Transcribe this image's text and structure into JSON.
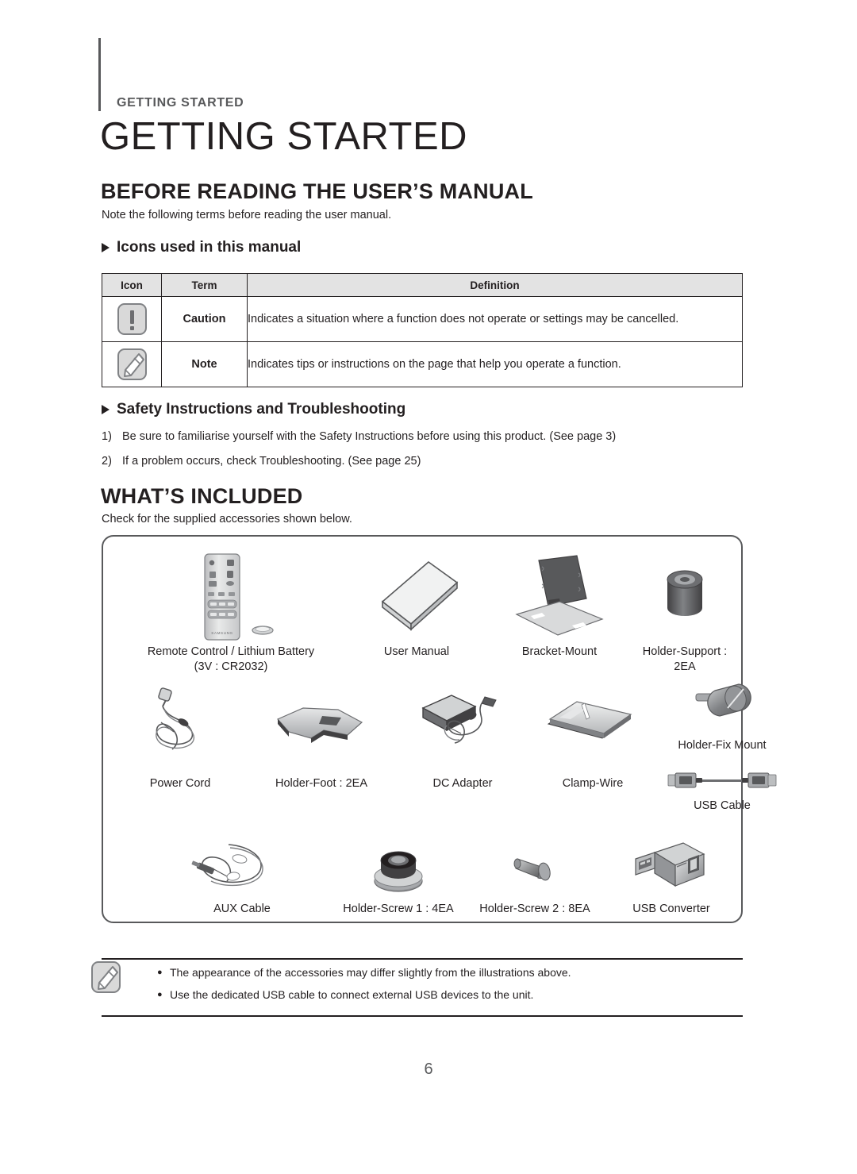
{
  "running_header": "GETTING STARTED",
  "chapter_title": "GETTING STARTED",
  "sections": {
    "before_reading": {
      "heading": "BEFORE READING THE USER’S MANUAL",
      "intro": "Note the following terms before reading the user manual.",
      "sub_icons_heading": "Icons used in this manual",
      "table": {
        "headers": [
          "Icon",
          "Term",
          "Definition"
        ],
        "rows": [
          {
            "icon": "caution-icon",
            "term": "Caution",
            "definition": "Indicates a situation where a function does not operate or settings may be cancelled."
          },
          {
            "icon": "note-pencil-icon",
            "term": "Note",
            "definition": "Indicates tips or instructions on the page that help you operate a function."
          }
        ]
      },
      "sub_safety_heading": "Safety Instructions and Troubleshooting",
      "safety_items": [
        {
          "num": "1)",
          "text": "Be sure to familiarise yourself with the Safety Instructions before using this product. (See page 3)"
        },
        {
          "num": "2)",
          "text": "If a problem occurs, check Troubleshooting. (See page 25)"
        }
      ]
    },
    "whats_included": {
      "heading": "WHAT’S INCLUDED",
      "intro": "Check for the supplied accessories shown below.",
      "accessories": [
        {
          "name": "remote-control",
          "label": "Remote Control / Lithium Battery\n(3V : CR2032)"
        },
        {
          "name": "user-manual",
          "label": "User Manual"
        },
        {
          "name": "bracket-mount",
          "label": "Bracket-Mount"
        },
        {
          "name": "holder-support",
          "label": "Holder-Support :\n2EA"
        },
        {
          "name": "power-cord",
          "label": "Power Cord"
        },
        {
          "name": "holder-foot",
          "label": "Holder-Foot : 2EA"
        },
        {
          "name": "dc-adapter",
          "label": "DC Adapter"
        },
        {
          "name": "clamp-wire",
          "label": "Clamp-Wire"
        },
        {
          "name": "holder-fix-mount",
          "label": "Holder-Fix Mount"
        },
        {
          "name": "usb-cable",
          "label": "USB Cable"
        },
        {
          "name": "aux-cable",
          "label": "AUX Cable"
        },
        {
          "name": "holder-screw-1",
          "label": "Holder-Screw 1 : 4EA"
        },
        {
          "name": "holder-screw-2",
          "label": "Holder-Screw 2 : 8EA"
        },
        {
          "name": "usb-converter",
          "label": "USB Converter"
        }
      ],
      "notes": [
        "The appearance of the accessories may differ slightly from the illustrations above.",
        "Use the dedicated USB cable to connect external USB devices to the unit."
      ]
    }
  },
  "remote_brand": "SAMSUNG",
  "page_number": "6",
  "colors": {
    "text": "#231f20",
    "muted": "#58595b",
    "table_header_bg": "#e3e3e3",
    "icon_fill": "#d9d9d9",
    "icon_stroke": "#808285"
  }
}
